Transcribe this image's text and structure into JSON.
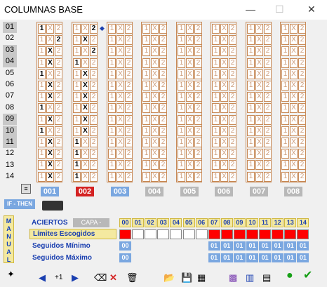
{
  "window": {
    "title": "COLUMNAS BASE",
    "minimize": "—",
    "maximize": "☐",
    "close": "✕"
  },
  "row_labels": [
    "01",
    "02",
    "03",
    "04",
    "05",
    "06",
    "07",
    "08",
    "09",
    "10",
    "11",
    "12",
    "13",
    "14"
  ],
  "column_numbers": [
    "001",
    "002",
    "003",
    "004",
    "005",
    "006",
    "007",
    "008"
  ],
  "columns": [
    [
      "1",
      "2",
      "X",
      "X",
      "1",
      "X",
      "X",
      "1",
      "X",
      "1",
      "X",
      "X",
      "X",
      "X"
    ],
    [
      "2",
      "X",
      "2",
      "1",
      "X",
      "X",
      "X",
      "X",
      "X",
      "X",
      "1",
      "1",
      "1",
      "1"
    ],
    [],
    [],
    [],
    [],
    [],
    []
  ],
  "ifthen_label": "IF - THEN",
  "manual_label": "MANUAL",
  "aciertos_label": "ACIERTOS",
  "capa_label": "CAPA -",
  "hits_header": [
    "00",
    "01",
    "02",
    "03",
    "04",
    "05",
    "06",
    "07",
    "08",
    "09",
    "10",
    "11",
    "12",
    "13",
    "14"
  ],
  "rows": {
    "limites_label": "Límites Escogidos",
    "seguidos_min_label": "Seguidos Mínimo",
    "seguidos_max_label": "Seguidos Máximo"
  },
  "limites_on": [
    true,
    false,
    false,
    false,
    false,
    false,
    false,
    true,
    true,
    true,
    true,
    true,
    true,
    true,
    true
  ],
  "seguidos_min": [
    "00",
    "",
    "",
    "",
    "",
    "",
    "",
    "01",
    "01",
    "01",
    "01",
    "01",
    "01",
    "01",
    "01"
  ],
  "seguidos_max": [
    "00",
    "",
    "",
    "",
    "",
    "",
    "",
    "01",
    "01",
    "01",
    "01",
    "01",
    "01",
    "01",
    "01"
  ],
  "toolbar": {
    "counter": "+1"
  }
}
